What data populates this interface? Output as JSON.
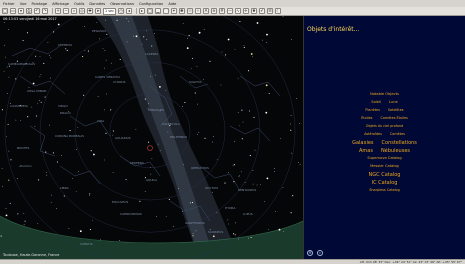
{
  "menu": [
    "Fichier",
    "Vue",
    "Pointage",
    "Affichage",
    "Outils",
    "Données",
    "Observations",
    "Configuration",
    "Aide"
  ],
  "toolbar": {
    "buttons": [
      "new",
      "open",
      "save",
      "print",
      "undo",
      "redo",
      "zoom-in",
      "zoom-out",
      "find",
      "center",
      "track",
      "slew",
      "now",
      "back",
      "forward",
      "fov",
      "ground",
      "horizon",
      "stars",
      "deep-sky",
      "solar-system",
      "constellation-lines",
      "constellation-names",
      "milky-way",
      "grid",
      "equator",
      "ecliptic",
      "satellites",
      "supernovae",
      "what-is-up",
      "observation-list",
      "night-mode"
    ],
    "step_value": "1 sec"
  },
  "sky": {
    "datetime": "06:13:03  vendredi 16 mai 2017",
    "location": "Toulouse, Haute-Garonne, France",
    "labels": [
      "CEPHEUS",
      "CAMELOPARDALIS",
      "URSA MINOR",
      "CASSIOPEIA",
      "DRACO",
      "CANES VENATICI",
      "LACERTA",
      "PEGASUS",
      "CYGNUS",
      "LYRA",
      "HERCULES",
      "BOOTES",
      "CORONA BOREALIS",
      "SAGITTA",
      "VULPECULA",
      "DELPHINUS",
      "AQUILA",
      "SERPENS",
      "OPHIUCHUS",
      "SCUTUM",
      "CAPRICORNUS",
      "SCORPIUS",
      "SAGITTARIUS",
      "LIBRA",
      "AQUARIUS",
      "VIRGO",
      "CORVUS",
      "HYDRA",
      "CENTAURUS",
      "LUPUS",
      "EQUULEUS",
      "Horizon"
    ]
  },
  "panel": {
    "title": "Objets d'intérêt...",
    "rows": [
      {
        "items": [
          "Notable Objects"
        ],
        "size": 3.6
      },
      {
        "items": [
          "Soleil",
          "Lune"
        ],
        "size": 3.6
      },
      {
        "items": [
          "Planètes",
          "Satellites"
        ],
        "size": 3.4
      },
      {
        "items": [
          "Étoiles",
          "Comètes Étoiles"
        ],
        "size": 3.4
      },
      {
        "items": [
          "Objets du ciel profond"
        ],
        "size": 3.4
      },
      {
        "items": [
          "Astéroïdes",
          "Comètes"
        ],
        "size": 3.4
      },
      {
        "items": [
          "Galaxies",
          "Constellations"
        ],
        "size": 5
      },
      {
        "items": [
          "Amas",
          "Nébuleuses"
        ],
        "size": 5
      },
      {
        "items": [
          "Supernova Catalog"
        ],
        "size": 3.6
      },
      {
        "items": [
          "Messier Catalog"
        ],
        "size": 3.6
      },
      {
        "items": [
          "NGC Catalog"
        ],
        "size": 5
      },
      {
        "items": [
          "IC Catalog"
        ],
        "size": 5
      },
      {
        "items": [
          "Sharpless Catalog"
        ],
        "size": 3.4
      }
    ]
  },
  "status": {
    "coords": "AH: 01h 48' 33\" Dec: +46° 24' 51\"  Az: 43° 07' 26\" Alt: +45° 55' 07\""
  },
  "colors": {
    "panel_background": "#000836",
    "panel_title": "#ffd85a",
    "panel_item": "#f0a81e",
    "sky_background": "#050608",
    "ground": "#1a3a2c",
    "milky_way": "#4a5a6e"
  }
}
